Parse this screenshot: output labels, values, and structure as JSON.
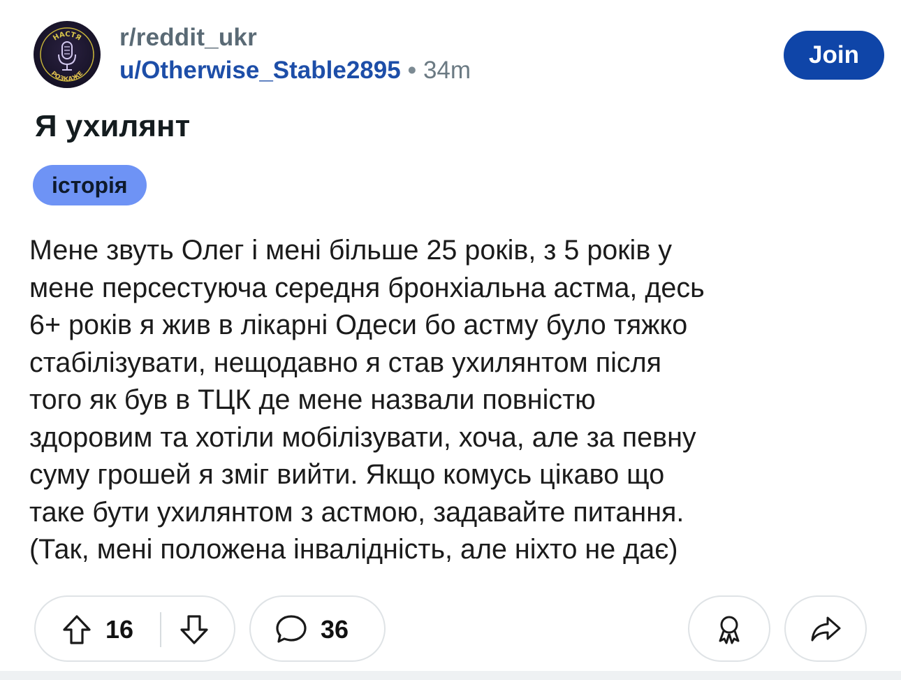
{
  "header": {
    "avatar_icon": "podcast-microphone-avatar-icon",
    "avatar_text_top": "НАСТЯ",
    "avatar_text_bottom": "РОЗКАЖЕ",
    "subreddit": "r/reddit_ukr",
    "username": "u/Otherwise_Stable2895",
    "separator": "•",
    "time_ago": "34m",
    "join_label": "Join"
  },
  "post": {
    "title": "Я ухилянт",
    "flair": "історія",
    "body_lines": [
      "Мене звуть Олег і мені більше 25 років, з 5 років у",
      "мене персестуюча середня бронхіальна астма, десь",
      "6+ років я жив в лікарні Одеси бо астму було тяжко",
      "стабілізувати, нещодавно я став ухилянтом після",
      "того як був в ТЦК де мене назвали повністю",
      "здоровим та хотіли мобілізувати, хоча, але за певну",
      "суму грошей я зміг вийти. Якщо комусь цікаво що",
      "таке бути ухилянтом з астмою, задавайте питання.",
      "(Так, мені положена інвалідність, але ніхто не дає)"
    ]
  },
  "actions": {
    "vote_count": "16",
    "comment_count": "36",
    "icons": [
      "upvote-icon",
      "downvote-icon",
      "comment-icon",
      "award-icon",
      "share-icon"
    ]
  },
  "colors": {
    "join_bg": "#0f45a8",
    "flair_bg": "#6e93f5",
    "username": "#1d4ea8",
    "border": "#dfe3e6"
  }
}
